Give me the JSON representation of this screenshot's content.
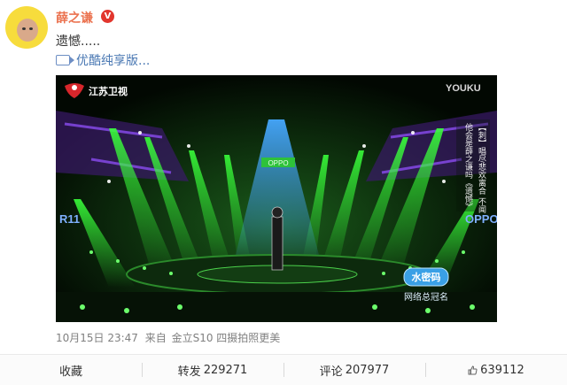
{
  "post": {
    "username": "薛之谦",
    "verified_badge": "V",
    "text": "遗憾.....",
    "video_link_label": "优酷纯享版...",
    "video_link_icon": "video-camera-icon"
  },
  "video": {
    "channel_logo_text": "江苏卫视",
    "watermark": "YOUKU",
    "stage_sign": "OPPO",
    "left_sign": "R11",
    "right_sign": "OPPO",
    "caption_column_1": "【刺】唱尽悲欢离合 不闻",
    "caption_column_2": "他会是薛之谦吗《遗憾》",
    "show_badge_title": "水密码",
    "show_badge_subtitle": "网络总冠名"
  },
  "meta": {
    "timestamp": "10月15日 23:47",
    "source_prefix": "来自",
    "source_device": "金立S10 四摄拍照更美"
  },
  "actions": {
    "favorite_label": "收藏",
    "repost_label": "转发",
    "repost_count": "229271",
    "comment_label": "评论",
    "comment_count": "207977",
    "like_count": "639112",
    "like_icon": "thumbs-up-icon"
  },
  "colors": {
    "username": "#eb7350",
    "link": "#4a78b3",
    "stage_green": "#39ff3a",
    "stage_purple": "#7a3ce0",
    "spotlight_blue": "#46a8ff"
  }
}
